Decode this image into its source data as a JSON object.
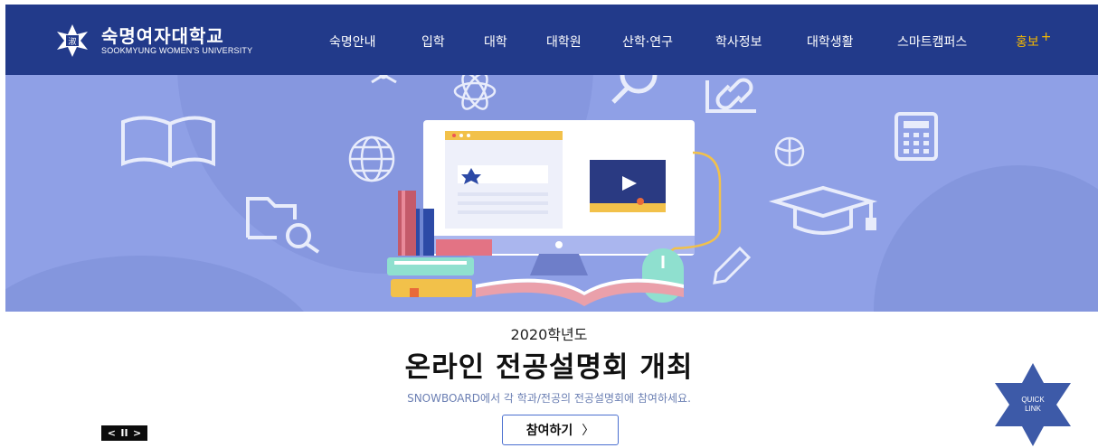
{
  "header": {
    "logo_ko": "숙명여자대학교",
    "logo_en": "SOOKMYUNG WOMEN'S UNIVERSITY",
    "bg_color": "#223a8a",
    "nav": [
      {
        "label": "숙명안내"
      },
      {
        "label": "입학"
      },
      {
        "label": "대학"
      },
      {
        "label": "대학원"
      },
      {
        "label": "산학·연구"
      },
      {
        "label": "학사정보"
      },
      {
        "label": "대학생활"
      },
      {
        "label": "스마트캠퍼스"
      },
      {
        "label": "홍보",
        "plus": "+",
        "color": "#f5b800"
      }
    ]
  },
  "banner": {
    "bg_color": "#8fa0e6",
    "icons": [
      "open-book-icon",
      "atom-icon",
      "magnifier-icon",
      "link-icon",
      "globe-icon",
      "basketball-icon",
      "calculator-icon",
      "folder-search-icon",
      "graduation-cap-icon",
      "pencil-icon",
      "computer-monitor-icon",
      "book-stack-icon",
      "mouse-icon"
    ]
  },
  "slide": {
    "year": "2020학년도",
    "headline": "온라인 전공설명회 개최",
    "subtext": "SNOWBOARD에서 각 학과/전공의 전공설명회에 참여하세요.",
    "button": "참여하기",
    "button_arrow": "〉"
  },
  "controls": {
    "prev": "<",
    "pause": "II",
    "next": ">"
  },
  "quick_link": {
    "line1": "QUICK",
    "line2": "LINK",
    "color": "#3d5aa8"
  }
}
